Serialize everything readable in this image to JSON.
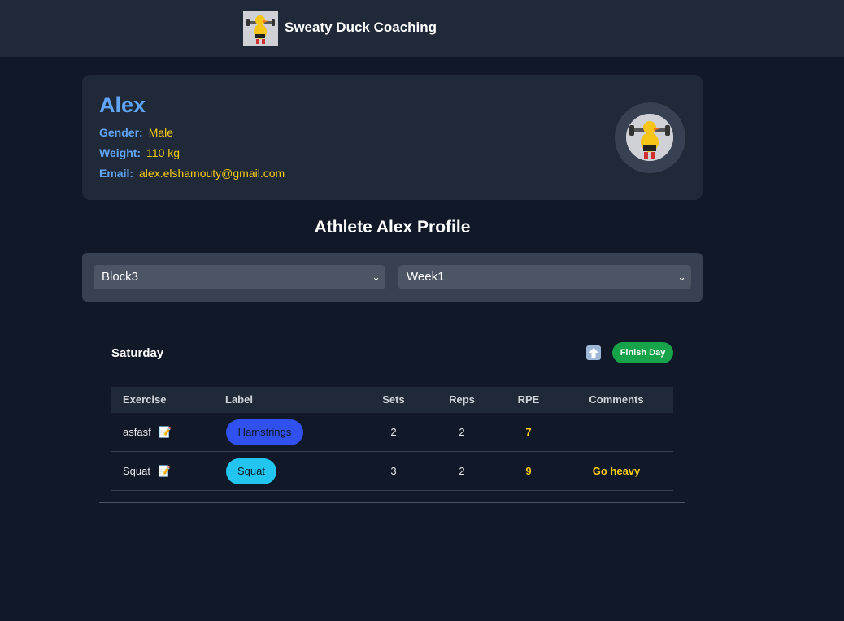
{
  "header": {
    "brand_title": "Sweaty Duck Coaching",
    "logo_icon": "duck-weightlifter-logo"
  },
  "profile": {
    "name": "Alex",
    "gender_label": "Gender:",
    "gender": "Male",
    "weight_label": "Weight:",
    "weight": "110 kg",
    "email_label": "Email:",
    "email": "alex.elshamouty@gmail.com",
    "avatar_icon": "duck-weightlifter-avatar"
  },
  "page_title": "Athlete Alex Profile",
  "selectors": {
    "block": "Block3",
    "week": "Week1"
  },
  "day": {
    "title": "Saturday",
    "upload_icon": "up-arrow-icon",
    "finish_label": "Finish Day"
  },
  "table": {
    "headers": [
      "Exercise",
      "Label",
      "Sets",
      "Reps",
      "RPE",
      "Comments"
    ],
    "rows": [
      {
        "exercise": "asfasf",
        "label": "Hamstrings",
        "label_color": "#3050f0",
        "sets": "2",
        "reps": "2",
        "rpe": "7",
        "comments": ""
      },
      {
        "exercise": "Squat",
        "label": "Squat",
        "label_color": "#22c5f0",
        "sets": "3",
        "reps": "2",
        "rpe": "9",
        "comments": "Go heavy"
      }
    ]
  },
  "colors": {
    "background": "#111827",
    "card": "#1f2937",
    "accent_blue": "#60a5fa",
    "accent_yellow": "#facc15",
    "finish_green": "#16a34a"
  }
}
